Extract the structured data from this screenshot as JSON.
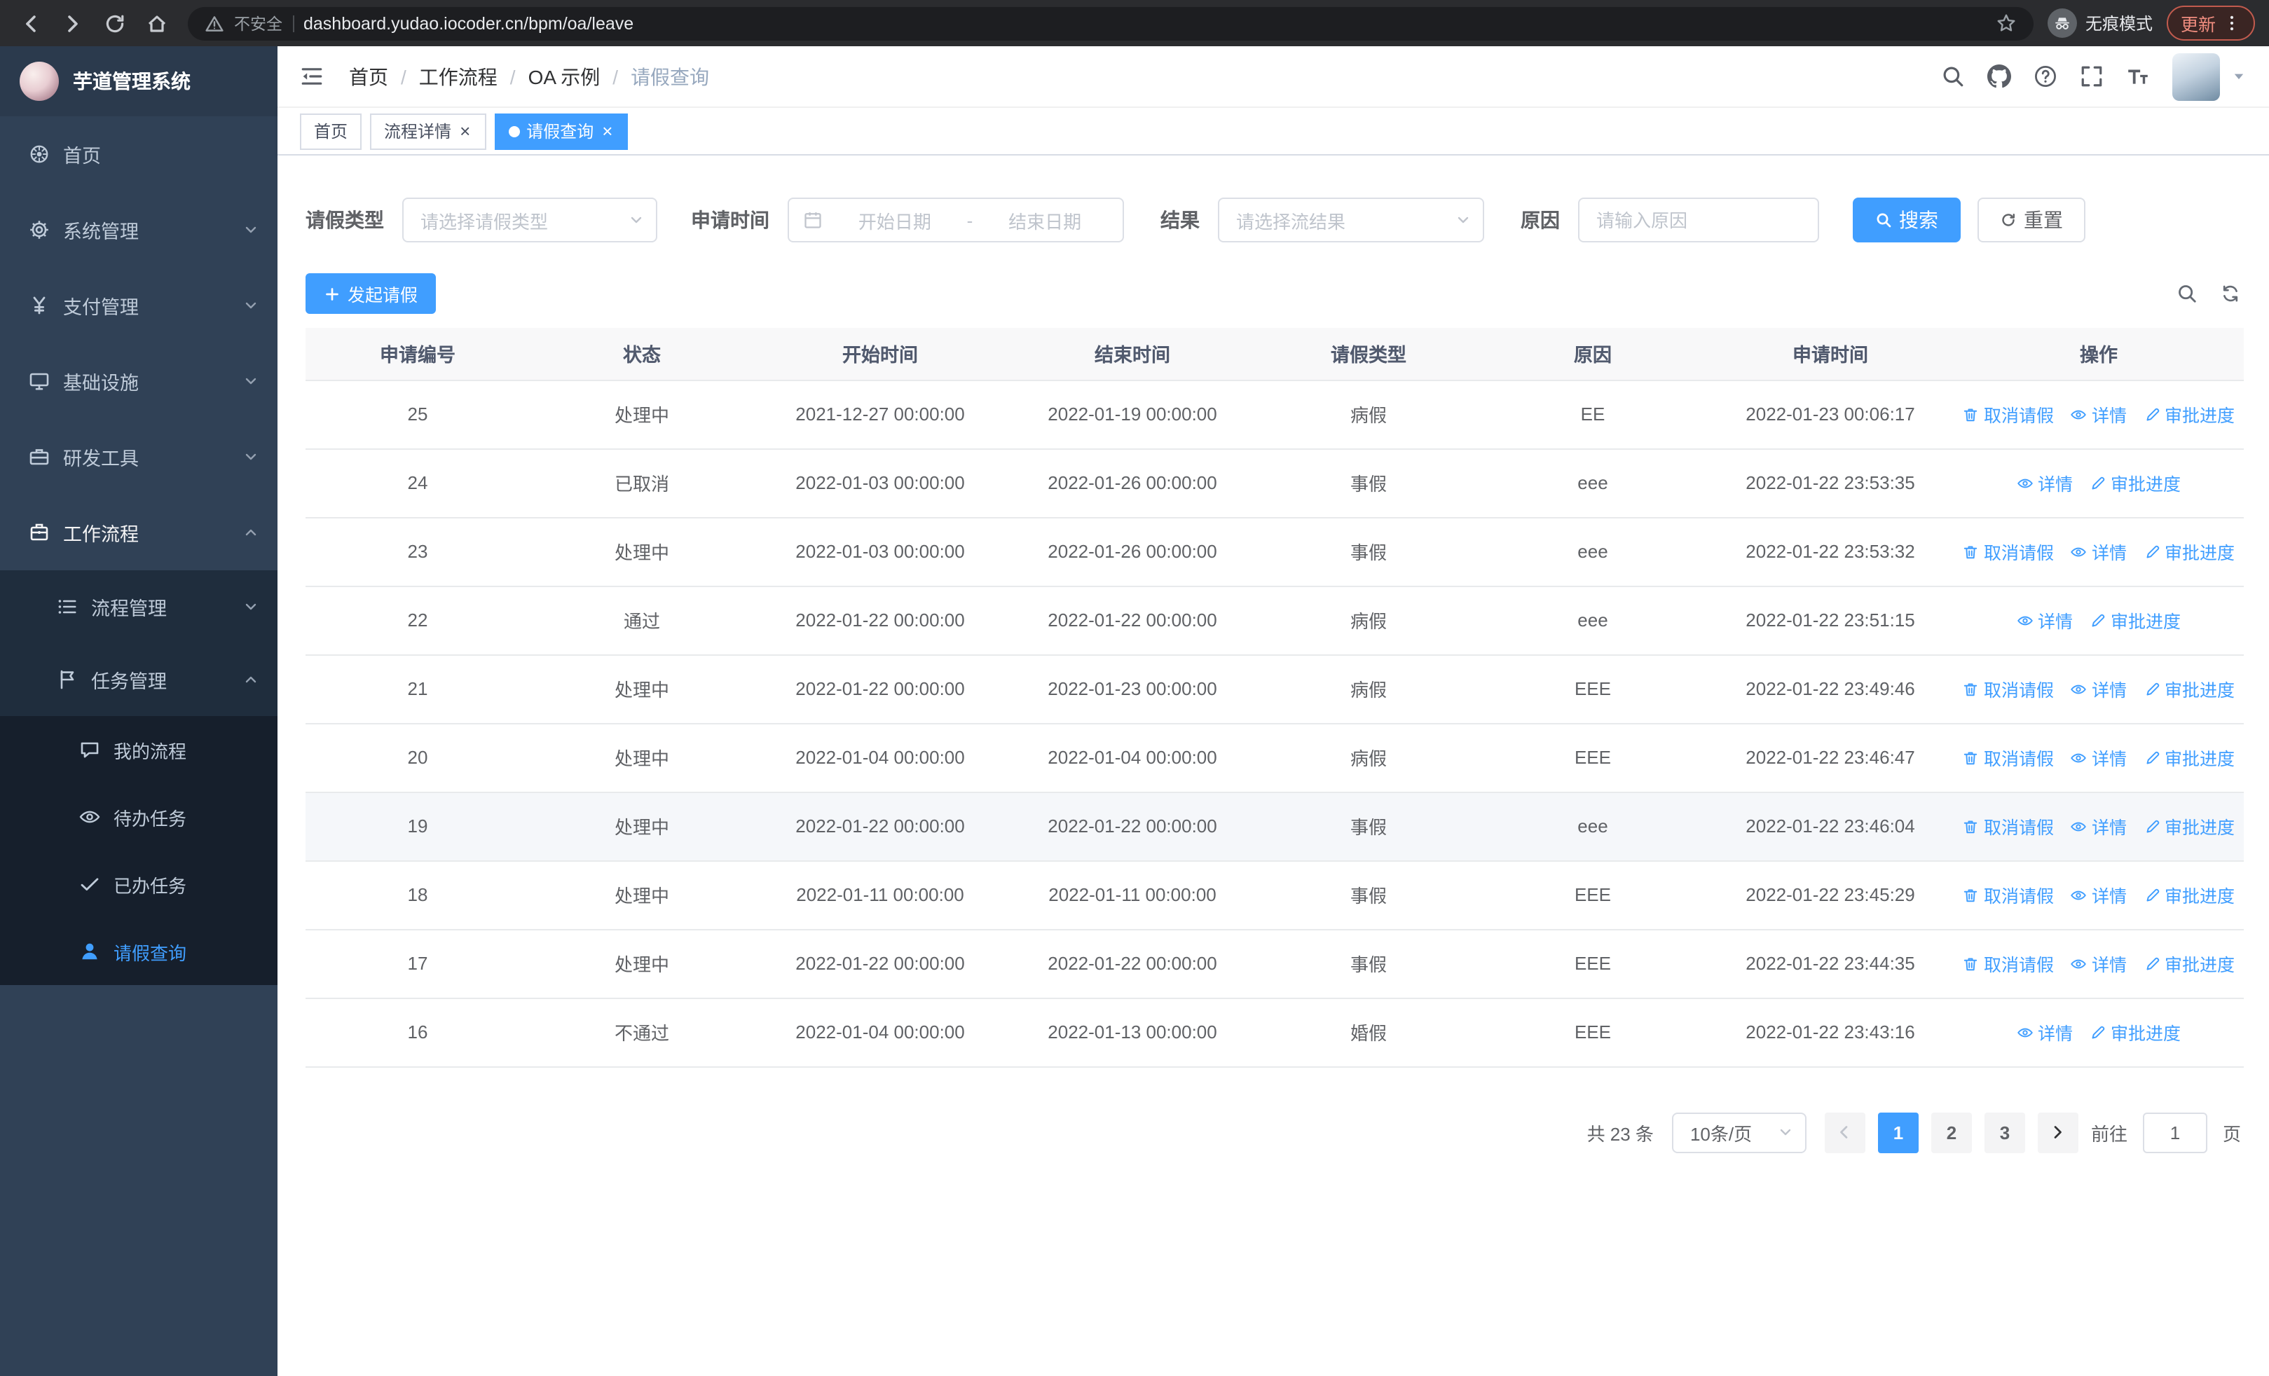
{
  "browser": {
    "security_label": "不安全",
    "url": "dashboard.yudao.iocoder.cn/bpm/oa/leave",
    "incognito_label": "无痕模式",
    "update_label": "更新"
  },
  "app": {
    "title": "芋道管理系统"
  },
  "sidebar": {
    "items": [
      {
        "label": "首页",
        "icon": "home-dashboard-icon",
        "level": 1,
        "chevron": null,
        "active": false,
        "highlight": false
      },
      {
        "label": "系统管理",
        "icon": "gear-icon",
        "level": 1,
        "chevron": "down",
        "active": false,
        "highlight": false
      },
      {
        "label": "支付管理",
        "icon": "payment-yen-icon",
        "level": 1,
        "chevron": "down",
        "active": false,
        "highlight": false
      },
      {
        "label": "基础设施",
        "icon": "infrastructure-icon",
        "level": 1,
        "chevron": "down",
        "active": false,
        "highlight": false
      },
      {
        "label": "研发工具",
        "icon": "devtools-icon",
        "level": 1,
        "chevron": "down",
        "active": false,
        "highlight": false
      },
      {
        "label": "工作流程",
        "icon": "workflow-icon",
        "level": 1,
        "chevron": "up",
        "active": false,
        "highlight": true
      },
      {
        "label": "流程管理",
        "icon": "process-manage-icon",
        "level": 2,
        "chevron": "down",
        "active": false,
        "highlight": false
      },
      {
        "label": "任务管理",
        "icon": "task-manage-icon",
        "level": 2,
        "chevron": "up",
        "active": false,
        "highlight": false
      },
      {
        "label": "我的流程",
        "icon": "my-process-icon",
        "level": 3,
        "chevron": null,
        "active": false,
        "highlight": false
      },
      {
        "label": "待办任务",
        "icon": "todo-task-icon",
        "level": 3,
        "chevron": null,
        "active": false,
        "highlight": false
      },
      {
        "label": "已办任务",
        "icon": "done-task-icon",
        "level": 3,
        "chevron": null,
        "active": false,
        "highlight": false
      },
      {
        "label": "请假查询",
        "icon": "leave-query-icon",
        "level": 3,
        "chevron": null,
        "active": true,
        "highlight": false
      }
    ]
  },
  "breadcrumb": {
    "separator": "/",
    "items": [
      "首页",
      "工作流程",
      "OA 示例",
      "请假查询"
    ]
  },
  "tags": [
    {
      "label": "首页",
      "closable": false,
      "active": false
    },
    {
      "label": "流程详情",
      "closable": true,
      "active": false
    },
    {
      "label": "请假查询",
      "closable": true,
      "active": true
    }
  ],
  "filters": {
    "leave_type_label": "请假类型",
    "leave_type_placeholder": "请选择请假类型",
    "apply_time_label": "申请时间",
    "start_date_placeholder": "开始日期",
    "range_separator": "-",
    "end_date_placeholder": "结束日期",
    "result_label": "结果",
    "result_placeholder": "请选择流结果",
    "reason_label": "原因",
    "reason_placeholder": "请输入原因",
    "search_button": "搜索",
    "reset_button": "重置"
  },
  "toolbar": {
    "create_label": "发起请假"
  },
  "table": {
    "columns": [
      "申请编号",
      "状态",
      "开始时间",
      "结束时间",
      "请假类型",
      "原因",
      "申请时间",
      "操作"
    ],
    "action_defs": {
      "cancel": {
        "label": "取消请假",
        "icon": "delete-icon",
        "name": "cancel-leave-link"
      },
      "detail": {
        "label": "详情",
        "icon": "eye-icon",
        "name": "detail-link"
      },
      "progress": {
        "label": "审批进度",
        "icon": "edit-icon",
        "name": "approval-progress-link"
      }
    },
    "rows": [
      {
        "id": "25",
        "status": "处理中",
        "start": "2021-12-27 00:00:00",
        "end": "2022-01-19 00:00:00",
        "type": "病假",
        "reason": "EE",
        "applied": "2022-01-23 00:06:17",
        "actions": [
          "cancel",
          "detail",
          "progress"
        ],
        "highlighted": false
      },
      {
        "id": "24",
        "status": "已取消",
        "start": "2022-01-03 00:00:00",
        "end": "2022-01-26 00:00:00",
        "type": "事假",
        "reason": "eee",
        "applied": "2022-01-22 23:53:35",
        "actions": [
          "detail",
          "progress"
        ],
        "highlighted": false
      },
      {
        "id": "23",
        "status": "处理中",
        "start": "2022-01-03 00:00:00",
        "end": "2022-01-26 00:00:00",
        "type": "事假",
        "reason": "eee",
        "applied": "2022-01-22 23:53:32",
        "actions": [
          "cancel",
          "detail",
          "progress"
        ],
        "highlighted": false
      },
      {
        "id": "22",
        "status": "通过",
        "start": "2022-01-22 00:00:00",
        "end": "2022-01-22 00:00:00",
        "type": "病假",
        "reason": "eee",
        "applied": "2022-01-22 23:51:15",
        "actions": [
          "detail",
          "progress"
        ],
        "highlighted": false
      },
      {
        "id": "21",
        "status": "处理中",
        "start": "2022-01-22 00:00:00",
        "end": "2022-01-23 00:00:00",
        "type": "病假",
        "reason": "EEE",
        "applied": "2022-01-22 23:49:46",
        "actions": [
          "cancel",
          "detail",
          "progress"
        ],
        "highlighted": false
      },
      {
        "id": "20",
        "status": "处理中",
        "start": "2022-01-04 00:00:00",
        "end": "2022-01-04 00:00:00",
        "type": "病假",
        "reason": "EEE",
        "applied": "2022-01-22 23:46:47",
        "actions": [
          "cancel",
          "detail",
          "progress"
        ],
        "highlighted": false
      },
      {
        "id": "19",
        "status": "处理中",
        "start": "2022-01-22 00:00:00",
        "end": "2022-01-22 00:00:00",
        "type": "事假",
        "reason": "eee",
        "applied": "2022-01-22 23:46:04",
        "actions": [
          "cancel",
          "detail",
          "progress"
        ],
        "highlighted": true
      },
      {
        "id": "18",
        "status": "处理中",
        "start": "2022-01-11 00:00:00",
        "end": "2022-01-11 00:00:00",
        "type": "事假",
        "reason": "EEE",
        "applied": "2022-01-22 23:45:29",
        "actions": [
          "cancel",
          "detail",
          "progress"
        ],
        "highlighted": false
      },
      {
        "id": "17",
        "status": "处理中",
        "start": "2022-01-22 00:00:00",
        "end": "2022-01-22 00:00:00",
        "type": "事假",
        "reason": "EEE",
        "applied": "2022-01-22 23:44:35",
        "actions": [
          "cancel",
          "detail",
          "progress"
        ],
        "highlighted": false
      },
      {
        "id": "16",
        "status": "不通过",
        "start": "2022-01-04 00:00:00",
        "end": "2022-01-13 00:00:00",
        "type": "婚假",
        "reason": "EEE",
        "applied": "2022-01-22 23:43:16",
        "actions": [
          "detail",
          "progress"
        ],
        "highlighted": false
      }
    ]
  },
  "pagination": {
    "total_text": "共 23 条",
    "page_size": "10条/页",
    "pages": [
      "1",
      "2",
      "3"
    ],
    "active_page": "1",
    "goto_label": "前往",
    "goto_value": "1",
    "goto_suffix": "页"
  }
}
